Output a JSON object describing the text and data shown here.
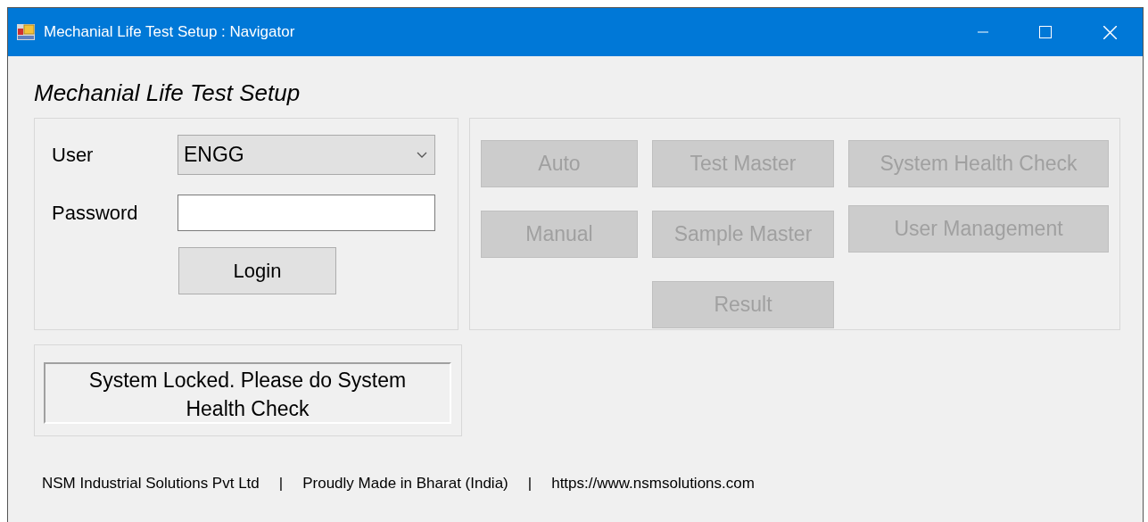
{
  "window": {
    "title": "Mechanial Life Test Setup : Navigator"
  },
  "heading": "Mechanial Life Test Setup",
  "login": {
    "user_label": "User",
    "user_value": "ENGG",
    "password_label": "Password",
    "login_button": "Login"
  },
  "nav_panel": {
    "columns": [
      {
        "buttons": [
          {
            "label": "Auto",
            "disabled": true
          },
          {
            "label": "Manual",
            "disabled": true
          }
        ]
      },
      {
        "buttons": [
          {
            "label": "Test Master",
            "disabled": true
          },
          {
            "label": "Sample Master",
            "disabled": true
          },
          {
            "label": "Result",
            "disabled": true
          }
        ]
      },
      {
        "buttons": [
          {
            "label": "System Health Check",
            "disabled": true
          },
          {
            "label": "User Management",
            "disabled": true
          }
        ]
      }
    ]
  },
  "status_message": "System Locked. Please do System Health Check",
  "footer": [
    "NSM Industrial Solutions Pvt Ltd",
    "|",
    "Proudly Made in Bharat (India)",
    "|",
    "https://www.nsmsolutions.com"
  ]
}
